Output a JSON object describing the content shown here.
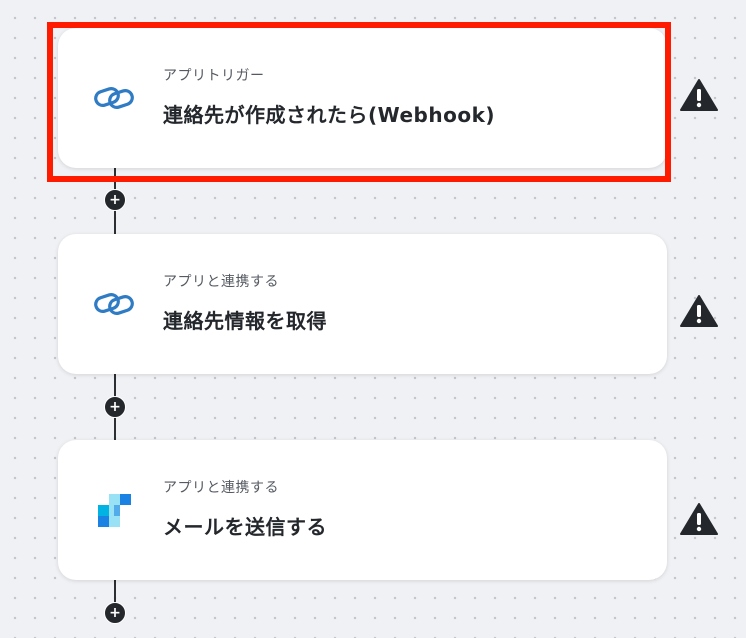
{
  "steps": [
    {
      "kind": "アプリトリガー",
      "title": "連絡先が作成されたら(Webhook)",
      "icon": "zoho-link-icon",
      "warning": "warning-icon"
    },
    {
      "kind": "アプリと連携する",
      "title": "連絡先情報を取得",
      "icon": "zoho-link-icon",
      "warning": "warning-icon"
    },
    {
      "kind": "アプリと連携する",
      "title": "メールを送信する",
      "icon": "sendgrid-icon",
      "warning": "warning-icon"
    }
  ],
  "add_button_symbol": "+",
  "colors": {
    "highlight": "#ff1b00",
    "link_icon": "#2f7bc4",
    "sendgrid_dark": "#1a82e2",
    "sendgrid_light": "#99e1f4",
    "warning": "#24272c"
  }
}
